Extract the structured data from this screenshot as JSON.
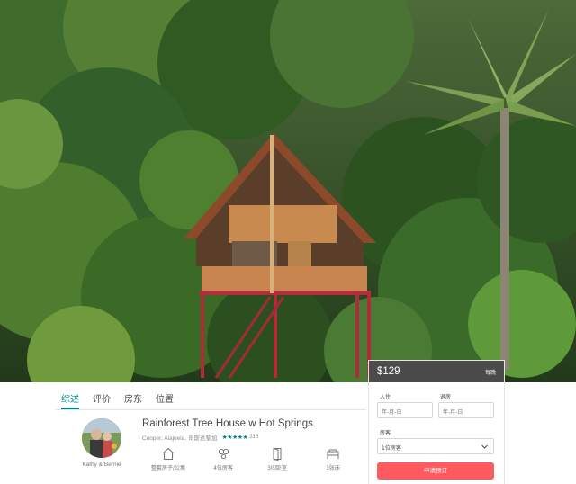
{
  "booking": {
    "price": "$129",
    "per_night": "每晚",
    "checkin_label": "入住",
    "checkout_label": "退房",
    "checkin_placeholder": "年-月-日",
    "checkout_placeholder": "年-月-日",
    "guests_label": "房客",
    "guests_value": "1位房客",
    "button_label": "申请预订"
  },
  "tabs": [
    {
      "label": "综述",
      "active": true
    },
    {
      "label": "评价",
      "active": false
    },
    {
      "label": "房东",
      "active": false
    },
    {
      "label": "位置",
      "active": false
    }
  ],
  "host": {
    "name": "Kathy & Bernie"
  },
  "listing": {
    "title": "Rainforest Tree House w Hot Springs",
    "location": "Cooper, Alajuela, 哥斯达黎加",
    "stars": "★★★★★",
    "reviews": "316"
  },
  "features": [
    {
      "label": "整套房子/公寓",
      "icon": "house-icon"
    },
    {
      "label": "4位房客",
      "icon": "guests-icon"
    },
    {
      "label": "3间卧室",
      "icon": "door-icon"
    },
    {
      "label": "3张床",
      "icon": "bed-icon"
    }
  ],
  "colors": {
    "accent": "#008489",
    "book_button": "#ff5a5f",
    "price_bar": "#333333"
  }
}
